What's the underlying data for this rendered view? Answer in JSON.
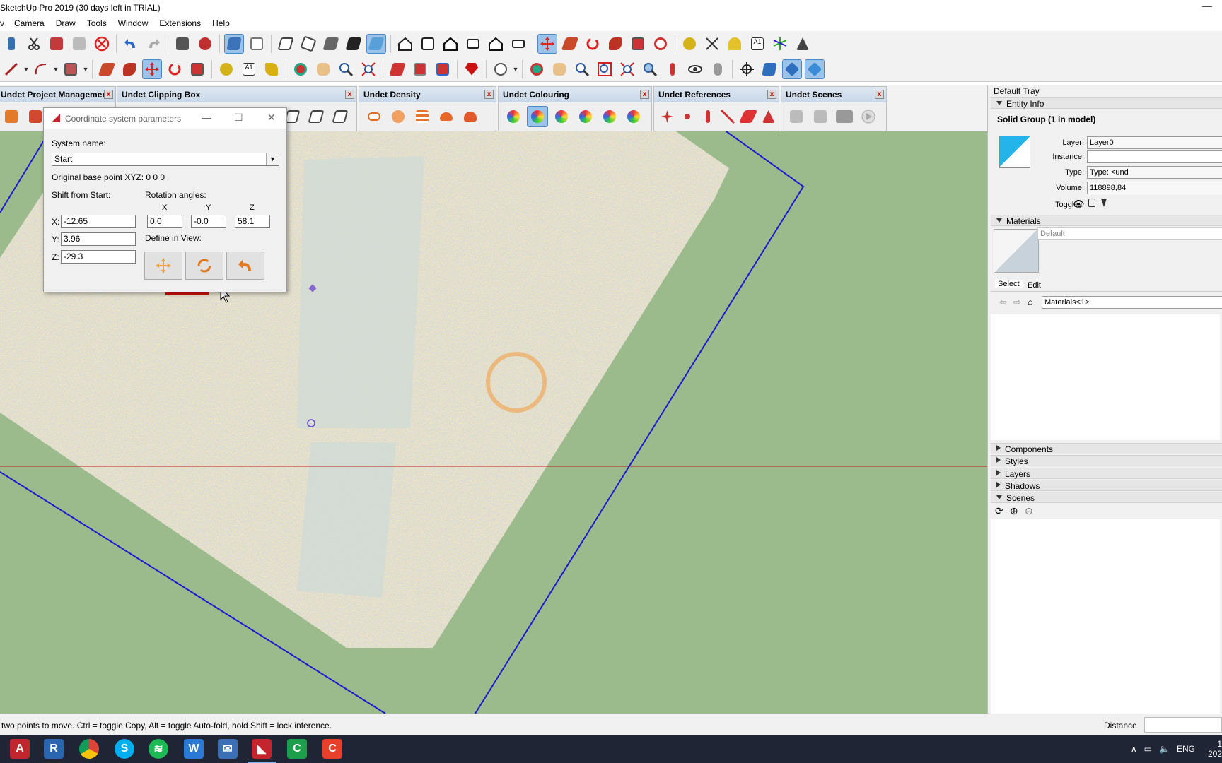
{
  "window": {
    "title": "SketchUp Pro 2019 (30 days left in TRIAL)",
    "minimize_glyph": "—"
  },
  "menu": [
    "Camera",
    "Draw",
    "Tools",
    "Window",
    "Extensions",
    "Help"
  ],
  "menu_first_fragment": "v",
  "panels": [
    {
      "title": "Undet Project Management"
    },
    {
      "title": "Undet Clipping Box"
    },
    {
      "title": "Undet Density"
    },
    {
      "title": "Undet Colouring"
    },
    {
      "title": "Undet References"
    },
    {
      "title": "Undet Scenes"
    }
  ],
  "panel_close": "x",
  "dialog": {
    "title": "Coordinate system parameters",
    "system_name_label": "System name:",
    "system_name_value": "Start",
    "base_point": "Original base point XYZ: 0 0 0",
    "shift_label": "Shift from Start:",
    "rotation_label": "Rotation angles:",
    "x_label": "X:",
    "y_label": "Y:",
    "z_label": "Z:",
    "shift_x": "-12.65",
    "shift_y": "3.96",
    "shift_z": "-29.3",
    "rot_head_x": "X",
    "rot_head_y": "Y",
    "rot_head_z": "Z",
    "rot_x": "0.0",
    "rot_y": "-0.0",
    "rot_z": "58.1",
    "define_label": "Define in View:",
    "min_glyph": "—",
    "max_glyph": "☐",
    "close_glyph": "✕"
  },
  "tray": {
    "title": "Default Tray",
    "entity_info": "Entity Info",
    "selection": "Solid Group (1 in model)",
    "layer_label": "Layer:",
    "layer_value": "Layer0",
    "instance_label": "Instance:",
    "instance_value": "",
    "type_label": "Type:",
    "type_value": "Type: <und",
    "volume_label": "Volume:",
    "volume_value": "118898,84",
    "toggles_label": "Toggles:",
    "materials": "Materials",
    "material_name": "Default",
    "tab_select": "Select",
    "tab_edit": "Edit",
    "materials_dropdown": "Materials<1>",
    "components": "Components",
    "styles": "Styles",
    "layers": "Layers",
    "shadows": "Shadows",
    "scenes": "Scenes"
  },
  "status": {
    "message": "two points to move.  Ctrl = toggle Copy, Alt = toggle Auto-fold, hold Shift = lock inference.",
    "distance_label": "Distance"
  },
  "taskbar": {
    "apps": [
      "autocad-icon",
      "revit-icon",
      "chrome-icon",
      "skype-icon",
      "spotify-icon",
      "word-icon",
      "mail-icon",
      "sketchup-icon",
      "camtasia-icon",
      "recorder-icon"
    ],
    "lang": "ENG",
    "clock_top": "1",
    "clock_bottom": "202"
  },
  "colors": {
    "viewport_bg": "#9bbb8c",
    "boundary": "#1a1ad0",
    "axis_red": "#c02020",
    "accent": "#4a88c7"
  }
}
